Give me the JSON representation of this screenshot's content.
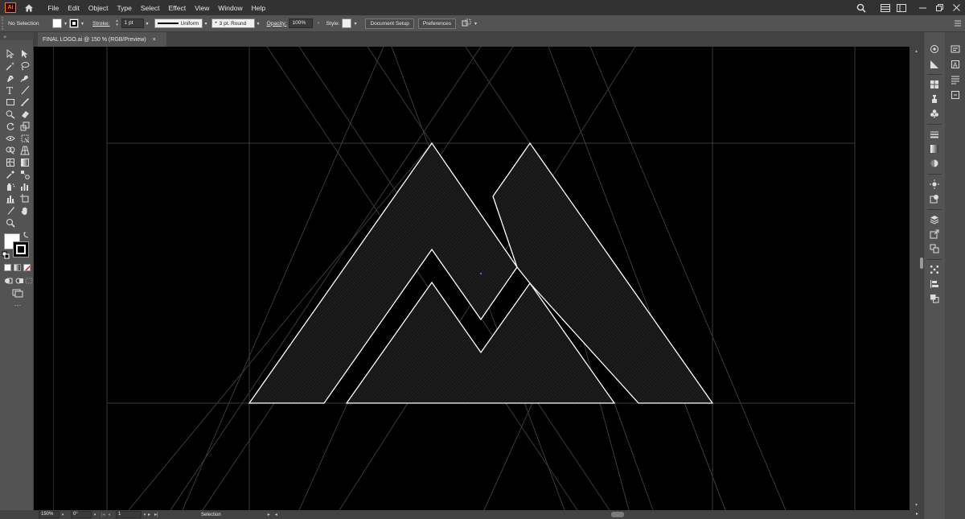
{
  "app": {
    "logo_text": "Ai",
    "menu": [
      "File",
      "Edit",
      "Object",
      "Type",
      "Select",
      "Effect",
      "View",
      "Window",
      "Help"
    ]
  },
  "controlbar": {
    "selection_label": "No Selection",
    "stroke_label": "Stroke:",
    "stroke_weight": "1 pt",
    "stroke_profile": "Uniform",
    "brush": "3 pt. Round",
    "opacity_label": "Opacity:",
    "opacity_value": "100%",
    "style_label": "Style:",
    "document_setup": "Document Setup",
    "preferences": "Preferences"
  },
  "document": {
    "tab_title": "FINAL LOGO.ai @ 150 % (RGB/Preview)",
    "close_glyph": "×"
  },
  "statusbar": {
    "zoom": "150%",
    "rotation": "0°",
    "artboard": "1",
    "mode": "Selection"
  },
  "colors": {
    "ui_dark": "#323232",
    "ui_mid": "#535353",
    "canvas": "#000000",
    "artwork_stroke": "#ffffff",
    "guide": "#3c3c3c",
    "ai_orange": "#ff7c00"
  }
}
